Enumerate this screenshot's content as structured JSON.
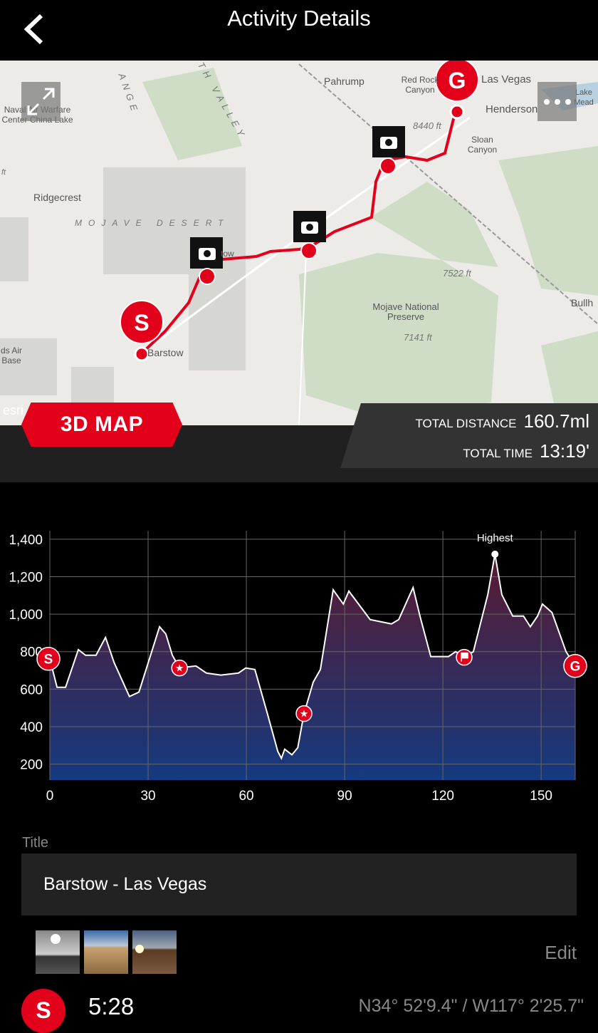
{
  "header": {
    "title": "Activity Details",
    "back_icon": "chevron-left-icon"
  },
  "map": {
    "labels": {
      "pahrump": "Pahrump",
      "red_rock": "Red Rock Canyon",
      "las_vegas": "Las Vegas",
      "henderson": "Henderson",
      "lake_mead": "Lake Mead",
      "naval": "Naval Air Warfare Center China Lake",
      "ridgecrest": "Ridgecrest",
      "mojave_desert": "MOJAVE DESERT",
      "death_valley": "TH VALLEY",
      "range": "ANGE",
      "elev_8440": "8440 ft",
      "sloan": "Sloan Canyon",
      "elev_7522": "7522 ft",
      "mojave_preserve": "Mojave National Preserve",
      "elev_7141": "7141 ft",
      "barstow": "Barstow",
      "bullhead": "Bullh",
      "base": "ds Air Base",
      "barstow_city": "tow",
      "esri": "esri",
      "ft": "ft"
    },
    "start_marker": "S",
    "goal_marker": "G",
    "route_color": "#e3001b"
  },
  "map_controls": {
    "three_d_label": "3D MAP",
    "expand_icon": "expand-icon",
    "more_icon": "more-dots-icon"
  },
  "stats": {
    "distance_label": "TOTAL DISTANCE",
    "distance_value": "160.7ml",
    "time_label": "TOTAL TIME",
    "time_value": "13:19'"
  },
  "chart_data": {
    "type": "area",
    "x": [
      0,
      2.2,
      4.8,
      8.7,
      10.9,
      14.1,
      17,
      19.6,
      24.3,
      27.2,
      33.5,
      35.4,
      37.4,
      39.6,
      44.6,
      47.8,
      52.2,
      57.6,
      59.8,
      62.6,
      66.3,
      69.6,
      70.7,
      71.7,
      73.9,
      75.7,
      77.6,
      80.4,
      82.6,
      86.5,
      89.6,
      91.3,
      97.8,
      104.3,
      106.5,
      110.9,
      113,
      116.3,
      121.7,
      123.9,
      126.5,
      129.3,
      133.7,
      135.9,
      138,
      141.3,
      144.6,
      146.7,
      148.9,
      150.4,
      153.3,
      157.6,
      160.4
    ],
    "y": [
      762,
      610,
      610,
      811,
      781,
      781,
      876,
      743,
      561,
      584,
      933,
      895,
      781,
      713,
      724,
      686,
      675,
      686,
      713,
      705,
      477,
      268,
      231,
      280,
      250,
      288,
      470,
      637,
      705,
      1130,
      1054,
      1123,
      971,
      948,
      971,
      1142,
      990,
      774,
      774,
      800,
      770,
      800,
      1104,
      1320,
      1104,
      990,
      990,
      933,
      990,
      1054,
      1009,
      800,
      724
    ],
    "xticks": [
      0,
      30,
      60,
      90,
      120,
      150
    ],
    "yticks": [
      200,
      400,
      600,
      800,
      1000,
      1200,
      1400
    ],
    "ytick_labels": [
      "200",
      "400",
      "600",
      "800",
      "1,000",
      "1,200",
      "1,400"
    ],
    "xlim": [
      0,
      160.4
    ],
    "ylim": [
      115,
      1445
    ],
    "grid": true,
    "annotations": [
      {
        "text": "Highest",
        "x": 135.9,
        "y": 1320
      }
    ],
    "markers": [
      {
        "type": "start",
        "label": "S",
        "x": 0,
        "y": 762
      },
      {
        "type": "photo-star",
        "x": 39.6,
        "y": 713
      },
      {
        "type": "photo-star",
        "x": 77.6,
        "y": 470
      },
      {
        "type": "flag",
        "x": 126.5,
        "y": 770
      },
      {
        "type": "goal",
        "label": "G",
        "x": 160.4,
        "y": 724
      }
    ],
    "fill_top_color": "#5a1a30",
    "fill_bottom_color": "#143a80",
    "line_color": "#ffffff",
    "marker_color": "#e3001b"
  },
  "details": {
    "title_label": "Title",
    "title_value": "Barstow - Las Vegas",
    "edit_label": "Edit",
    "photos": 3,
    "start_badge": "S",
    "start_time": "5:28",
    "coordinates": "N34° 52'9.4\" / W117° 2'25.7\""
  }
}
